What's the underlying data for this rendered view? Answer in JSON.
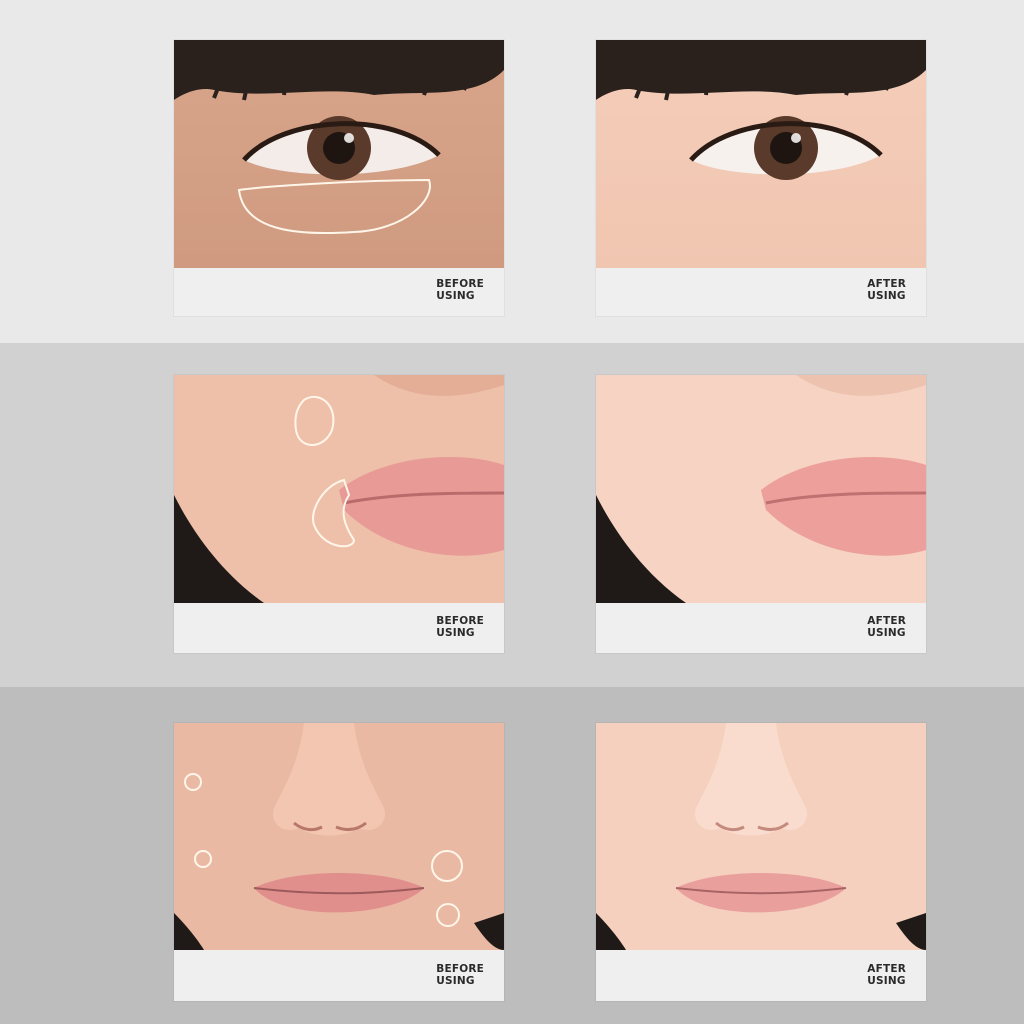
{
  "rows": [
    {
      "area": "eye",
      "before": {
        "caption_line1": "BEFORE",
        "caption_line2": "USING"
      },
      "after": {
        "caption_line1": "AFTER",
        "caption_line2": "USING"
      }
    },
    {
      "area": "cheek-lips",
      "before": {
        "caption_line1": "BEFORE",
        "caption_line2": "USING"
      },
      "after": {
        "caption_line1": "AFTER",
        "caption_line2": "USING"
      }
    },
    {
      "area": "nose-lips",
      "before": {
        "caption_line1": "BEFORE",
        "caption_line2": "USING"
      },
      "after": {
        "caption_line1": "AFTER",
        "caption_line2": "USING"
      }
    }
  ],
  "colors": {
    "skin_before": "#d9a78e",
    "skin_after": "#f2c9b4",
    "lips": "#e79a96",
    "highlight_outline": "#fff6ea"
  }
}
